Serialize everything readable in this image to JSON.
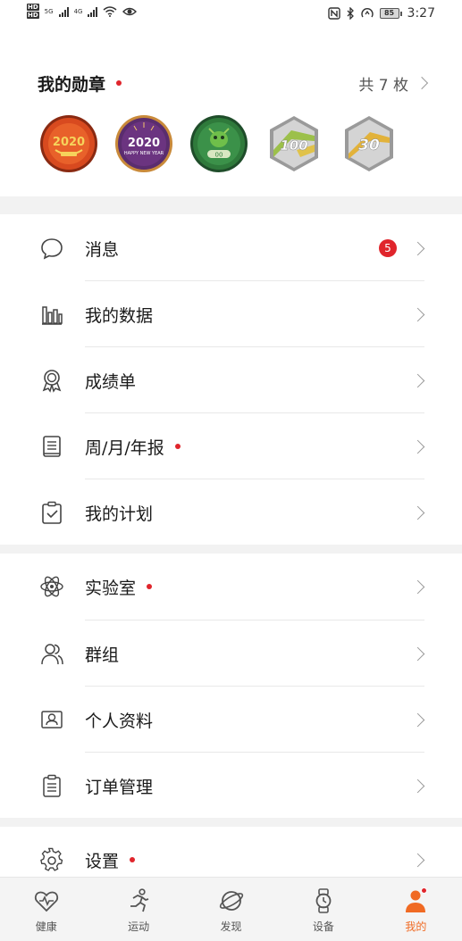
{
  "status_bar": {
    "hd1": "HD",
    "hd2": "HD",
    "net1": "5G",
    "net2": "4G",
    "battery": "85",
    "time": "3:27"
  },
  "medals": {
    "title": "我的勋章",
    "count": "共 7 枚",
    "items": [
      {
        "name": "2020 金鼠勋章",
        "text": "2020"
      },
      {
        "name": "2020 新年勋章",
        "text": "2020",
        "sub": "HAPPY NEW YEAR"
      },
      {
        "name": "绿色纪念勋章",
        "text": "00"
      },
      {
        "name": "100 勋章",
        "text": "100"
      },
      {
        "name": "30 勋章",
        "text": "30"
      }
    ]
  },
  "list": [
    {
      "label": "消息",
      "icon": "message-icon",
      "badge": "5",
      "dot": false
    },
    {
      "label": "我的数据",
      "icon": "bar-chart-icon",
      "dot": false
    },
    {
      "label": "成绩单",
      "icon": "award-icon",
      "dot": false
    },
    {
      "label": "周/月/年报",
      "icon": "report-icon",
      "dot": true
    },
    {
      "label": "我的计划",
      "icon": "plan-icon",
      "dot": false
    },
    {
      "label": "实验室",
      "icon": "atom-icon",
      "dot": true
    },
    {
      "label": "群组",
      "icon": "group-icon",
      "dot": false
    },
    {
      "label": "个人资料",
      "icon": "profile-card-icon",
      "dot": false
    },
    {
      "label": "订单管理",
      "icon": "order-icon",
      "dot": false
    },
    {
      "label": "设置",
      "icon": "gear-icon",
      "dot": true
    }
  ],
  "nav": [
    {
      "label": "健康",
      "icon": "heart-icon",
      "active": false
    },
    {
      "label": "运动",
      "icon": "runner-icon",
      "active": false
    },
    {
      "label": "发现",
      "icon": "planet-icon",
      "active": false
    },
    {
      "label": "设备",
      "icon": "watch-icon",
      "active": false
    },
    {
      "label": "我的",
      "icon": "person-icon",
      "active": true
    }
  ],
  "colors": {
    "accent": "#f06a23",
    "badge_red": "#e0252c",
    "separator": "#f2f2f2"
  }
}
